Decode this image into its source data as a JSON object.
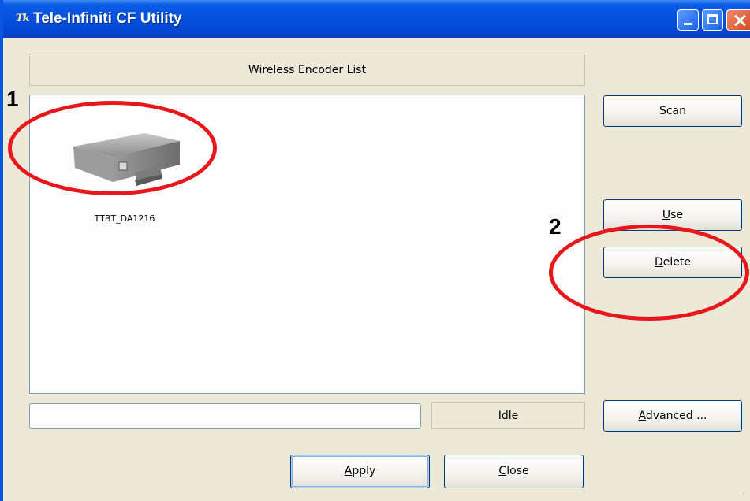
{
  "window": {
    "title": "Tele-Infiniti CF Utility",
    "icon_glyph": "Tk"
  },
  "list": {
    "header": "Wireless Encoder List",
    "items": [
      {
        "label": "TTBT_DA1216",
        "icon": "encoder-device-icon"
      }
    ]
  },
  "buttons": {
    "scan": "Scan",
    "use": "Use",
    "delete": "Delete",
    "advanced": "Advanced ...",
    "apply": "Apply",
    "close": "Close"
  },
  "status": {
    "input_value": "",
    "state": "Idle"
  },
  "annotations": {
    "one": "1",
    "two": "2",
    "color": "#e8171b"
  },
  "colors": {
    "titlebar": "#0550dc",
    "window_bg": "#ece9d8",
    "button_border": "#003c74"
  }
}
